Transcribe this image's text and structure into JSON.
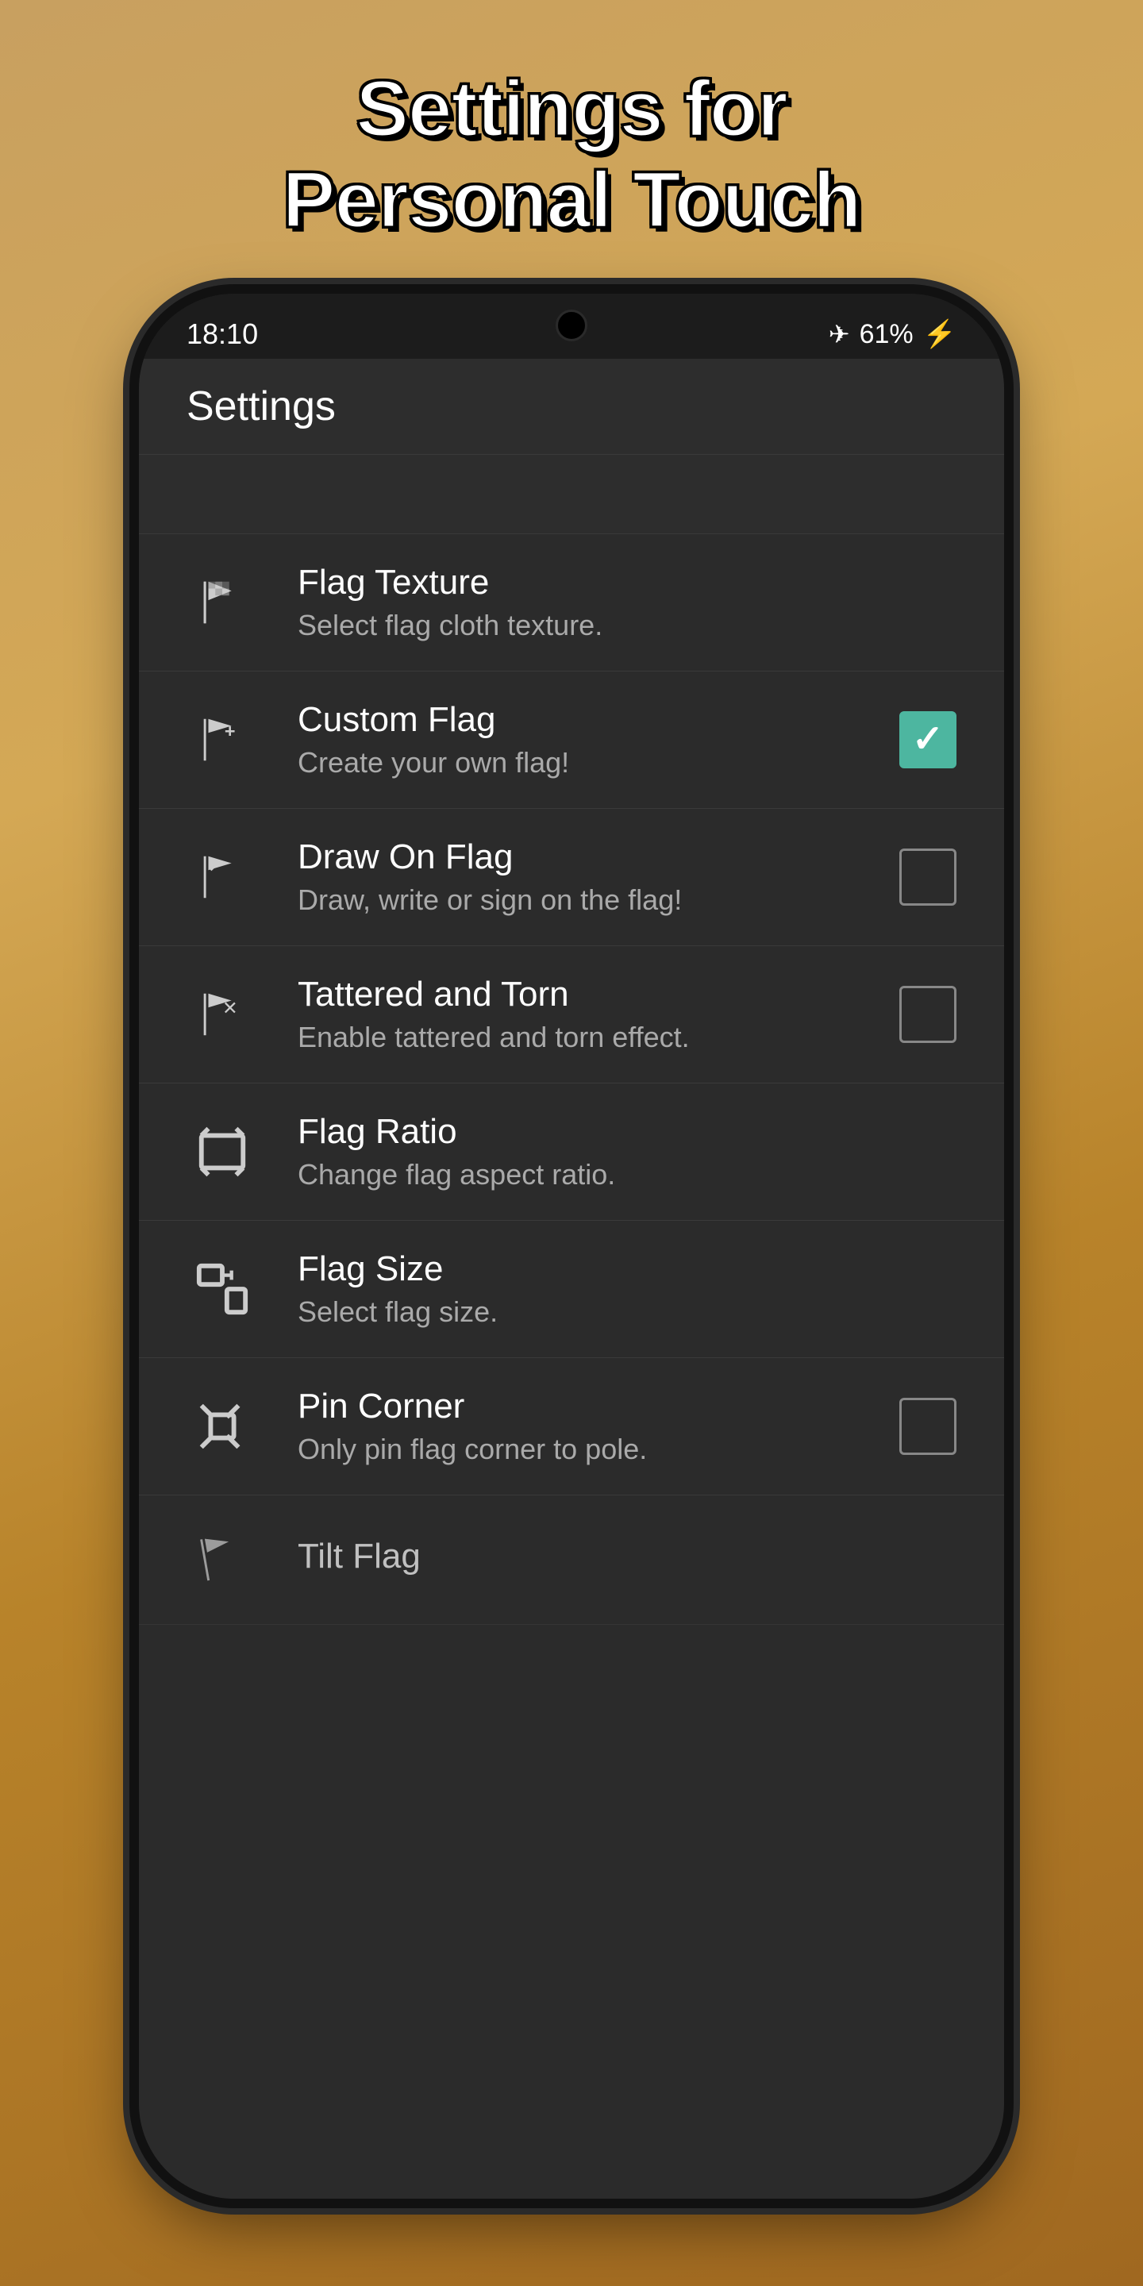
{
  "page": {
    "title_line1": "Settings for",
    "title_line2": "Personal Touch"
  },
  "status_bar": {
    "time": "18:10",
    "battery": "61%",
    "airplane_mode": true
  },
  "app_bar": {
    "title": "Settings"
  },
  "settings_items": [
    {
      "id": "flag-texture",
      "title": "Flag Texture",
      "subtitle": "Select flag cloth texture.",
      "icon": "flag-texture-icon",
      "has_checkbox": false
    },
    {
      "id": "custom-flag",
      "title": "Custom Flag",
      "subtitle": "Create your own flag!",
      "icon": "custom-flag-icon",
      "has_checkbox": true,
      "checked": true
    },
    {
      "id": "draw-on-flag",
      "title": "Draw On Flag",
      "subtitle": "Draw, write or sign on the flag!",
      "icon": "draw-flag-icon",
      "has_checkbox": true,
      "checked": false
    },
    {
      "id": "tattered-torn",
      "title": "Tattered and Torn",
      "subtitle": "Enable tattered and torn effect.",
      "icon": "tattered-flag-icon",
      "has_checkbox": true,
      "checked": false
    },
    {
      "id": "flag-ratio",
      "title": "Flag Ratio",
      "subtitle": "Change flag aspect ratio.",
      "icon": "flag-ratio-icon",
      "has_checkbox": false
    },
    {
      "id": "flag-size",
      "title": "Flag Size",
      "subtitle": "Select flag size.",
      "icon": "flag-size-icon",
      "has_checkbox": false
    },
    {
      "id": "pin-corner",
      "title": "Pin Corner",
      "subtitle": "Only pin flag corner to pole.",
      "icon": "pin-corner-icon",
      "has_checkbox": true,
      "checked": false
    },
    {
      "id": "tilt-flag",
      "title": "Tilt Flag",
      "subtitle": "",
      "icon": "tilt-flag-icon",
      "has_checkbox": false
    }
  ]
}
